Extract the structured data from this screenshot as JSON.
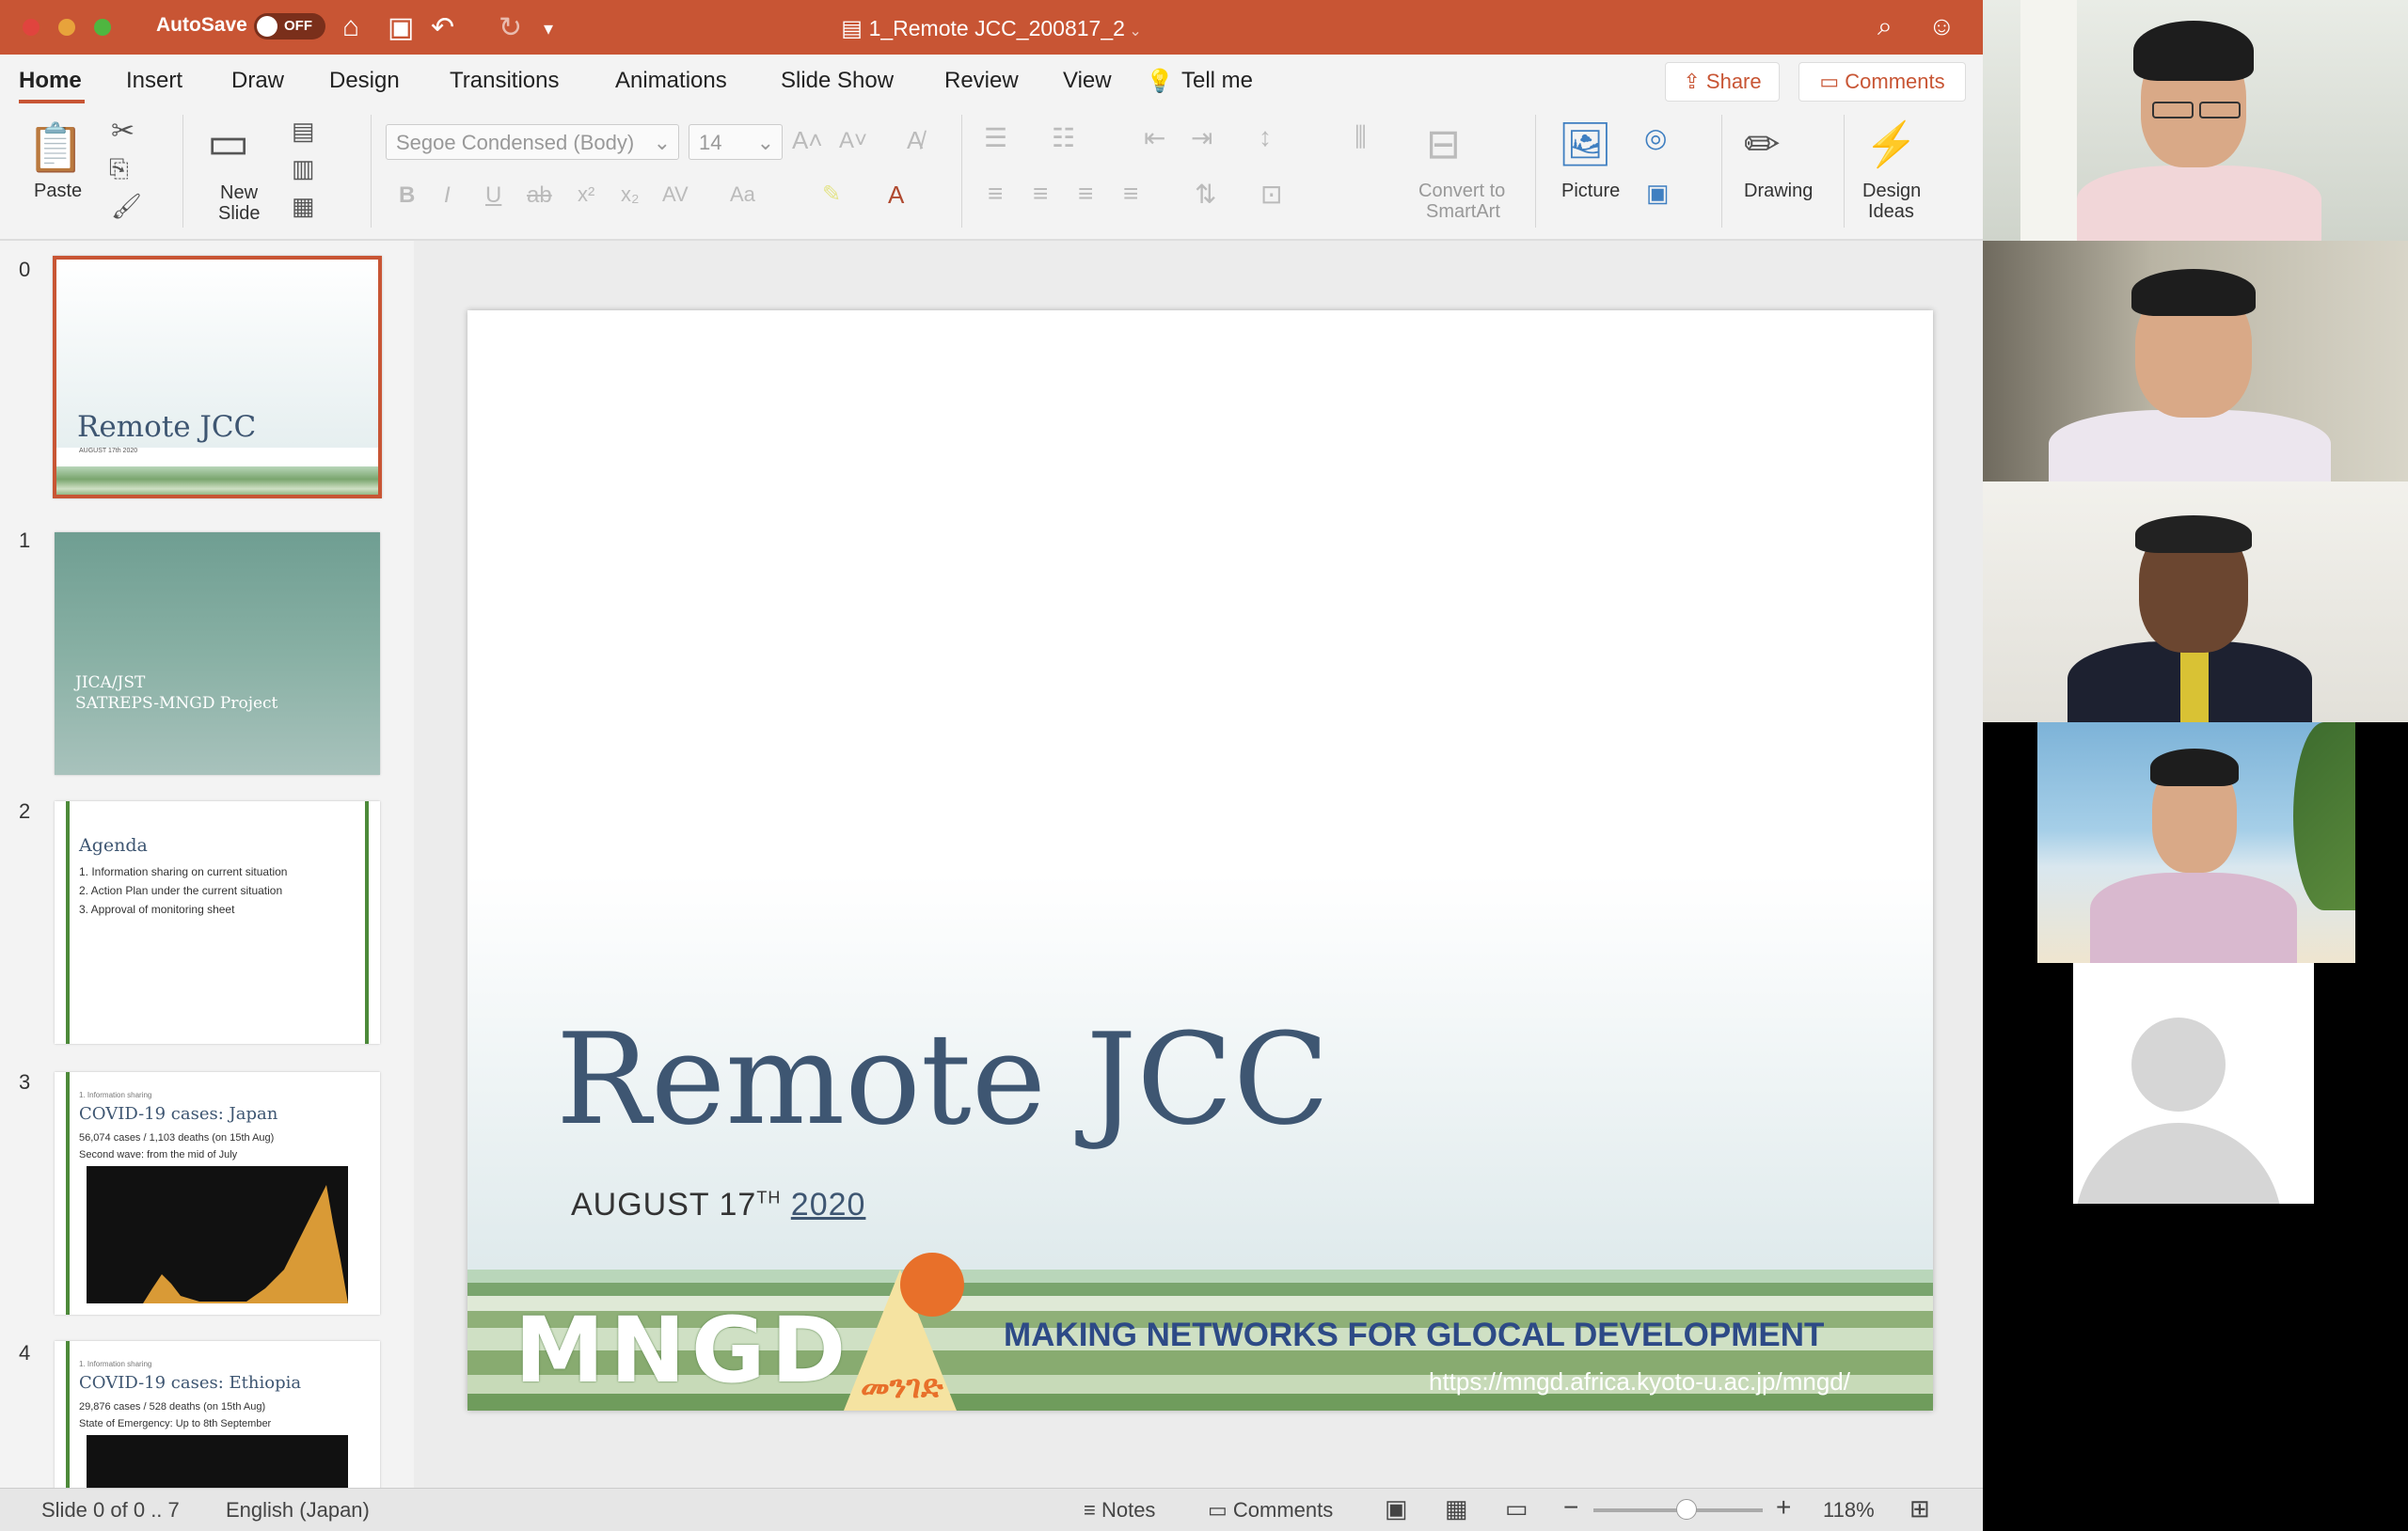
{
  "app": {
    "autosave_label": "AutoSave",
    "autosave_state": "OFF",
    "doc_title": "1_Remote JCC_200817_2"
  },
  "menu": {
    "tabs": [
      "Home",
      "Insert",
      "Draw",
      "Design",
      "Transitions",
      "Animations",
      "Slide Show",
      "Review",
      "View"
    ],
    "active_tab": "Home",
    "tell_me": "Tell me",
    "share": "Share",
    "comments": "Comments"
  },
  "ribbon": {
    "paste": "Paste",
    "new_slide_line1": "New",
    "new_slide_line2": "Slide",
    "font_name": "Segoe Condensed (Body)",
    "font_size": "14",
    "convert_line1": "Convert to",
    "convert_line2": "SmartArt",
    "picture": "Picture",
    "drawing": "Drawing",
    "design_ideas_line1": "Design",
    "design_ideas_line2": "Ideas"
  },
  "thumbnails": [
    {
      "num": "0",
      "title": "Remote JCC",
      "sub": "AUGUST 17th 2020"
    },
    {
      "num": "1",
      "title_line1": "JICA/JST",
      "title_line2": "SATREPS-MNGD Project"
    },
    {
      "num": "2",
      "title": "Agenda",
      "items": [
        "1.  Information sharing on current situation",
        "2.  Action Plan under the current situation",
        "3.  Approval of monitoring sheet"
      ]
    },
    {
      "num": "3",
      "kicker": "1. Information sharing",
      "title": "COVID-19 cases: Japan",
      "items": [
        "56,074 cases / 1,103 deaths (on 15th Aug)",
        "Second wave: from the mid of July"
      ]
    },
    {
      "num": "4",
      "kicker": "1. Information sharing",
      "title": "COVID-19 cases: Ethiopia",
      "items": [
        "29,876 cases / 528 deaths (on 15th Aug)",
        "State of Emergency: Up to 8th September"
      ]
    }
  ],
  "slide": {
    "title": "Remote JCC",
    "date_prefix": "AUGUST 17",
    "date_sup": "TH",
    "date_year": "2020",
    "logo": "MNGD",
    "amharic": "መንገድ",
    "tagline": "MAKING NETWORKS FOR GLOCAL DEVELOPMENT",
    "url": "https://mngd.africa.kyoto-u.ac.jp/mngd/"
  },
  "status": {
    "slide_info": "Slide 0 of 0 .. 7",
    "language": "English (Japan)",
    "notes": "Notes",
    "comments": "Comments",
    "zoom": "118%"
  },
  "colors": {
    "accent": "#c85534",
    "title_blue": "#3e5672",
    "tagline_blue": "#2d4a86"
  }
}
